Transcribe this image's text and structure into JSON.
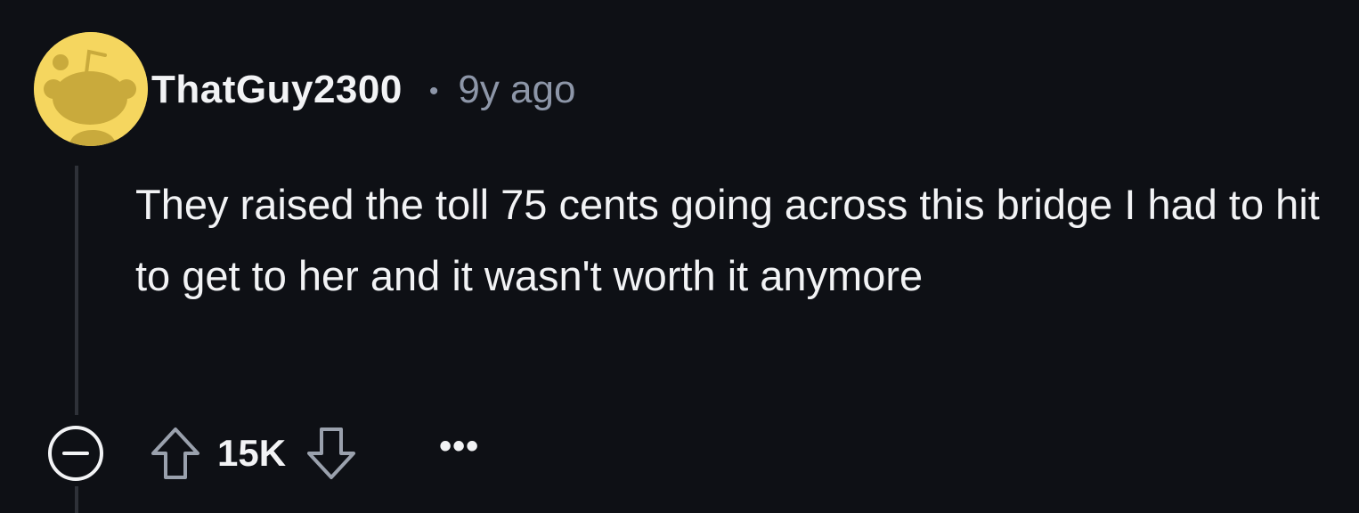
{
  "comment": {
    "author": "ThatGuy2300",
    "separator": "•",
    "timestamp": "9y ago",
    "body": "They raised the toll 75 cents going across this bridge I had to hit to get to her and it wasn't worth it anymore",
    "score": "15K",
    "more_label": "•••"
  },
  "icons": {
    "avatar": "snoo-avatar-icon",
    "collapse": "collapse-minus-icon",
    "upvote": "upvote-arrow-icon",
    "downvote": "downvote-arrow-icon",
    "more": "more-options-icon"
  },
  "colors": {
    "background": "#0e1015",
    "text": "#f2f3f5",
    "muted": "#8d96a8",
    "avatar_bg": "#f5d65f",
    "avatar_figure": "#c9aa3c",
    "thread_line": "#2e3138"
  }
}
